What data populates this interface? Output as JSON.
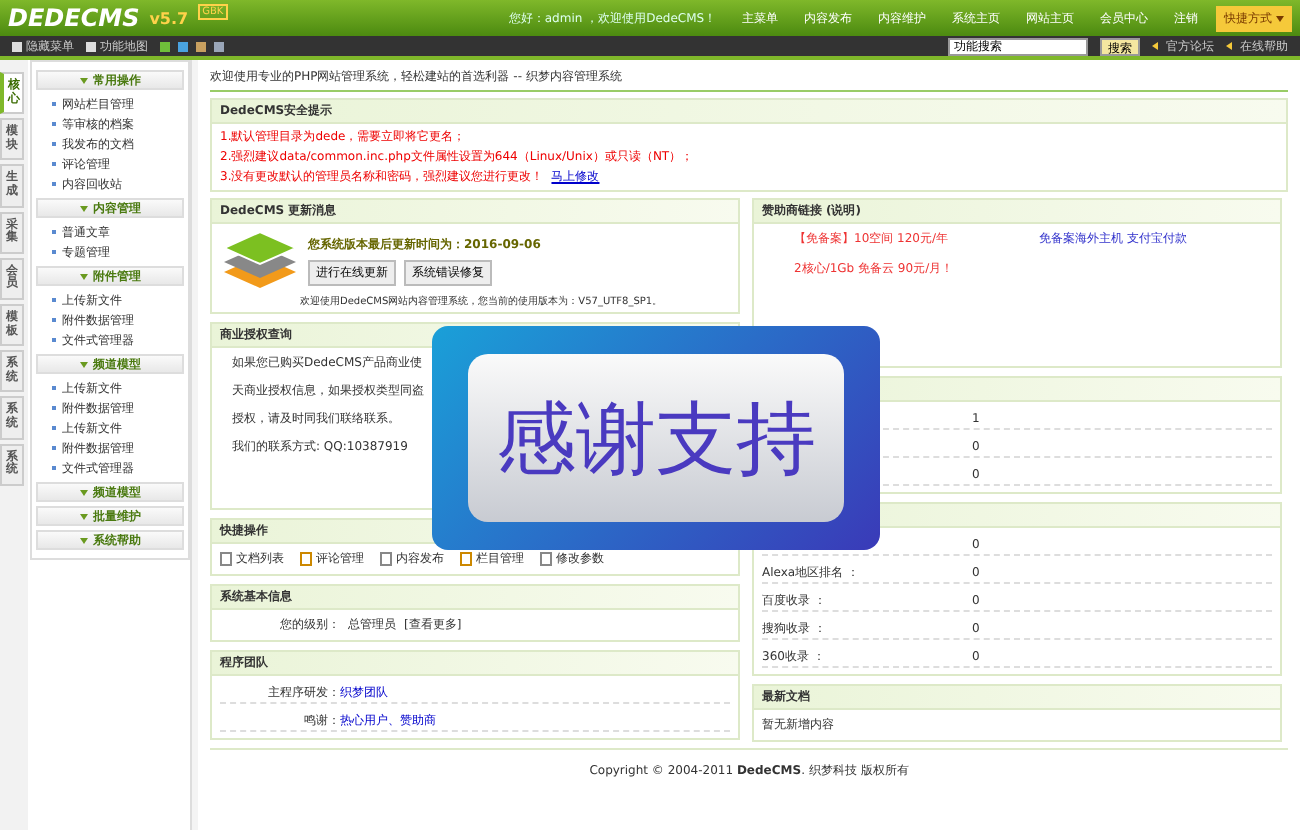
{
  "header": {
    "logo": "DEDECMS",
    "version": "v5.7",
    "edition": "GBK",
    "greeting": "您好：admin ，欢迎使用DedeCMS！",
    "nav": [
      "主菜单",
      "内容发布",
      "内容维护",
      "系统主页",
      "网站主页",
      "会员中心",
      "注销"
    ],
    "shortcut": "快捷方式"
  },
  "toolbar": {
    "hide_menu": "隐藏菜单",
    "map": "功能地图",
    "skins": [
      {
        "color": "#6fbf3a"
      },
      {
        "color": "#4aa3df"
      },
      {
        "color": "#c8a060"
      },
      {
        "color": "#9aa6b8"
      }
    ],
    "search": {
      "value": "功能搜索"
    },
    "search_button": "搜索",
    "links": [
      "官方论坛",
      "在线帮助"
    ]
  },
  "side_tabs": [
    {
      "label": "核心",
      "selected": true
    },
    {
      "label": "模块",
      "selected": false
    },
    {
      "label": "生成",
      "selected": false
    },
    {
      "label": "采集",
      "selected": false
    },
    {
      "label": "会员",
      "selected": false
    },
    {
      "label": "模板",
      "selected": false
    },
    {
      "label": "系统",
      "selected": false
    },
    {
      "label": "系统",
      "selected": false
    },
    {
      "label": "系统",
      "selected": false
    }
  ],
  "menu": [
    {
      "title": "常用操作",
      "items": [
        "网站栏目管理",
        "等审核的档案",
        "我发布的文档",
        "评论管理",
        "内容回收站"
      ]
    },
    {
      "title": "内容管理",
      "items": [
        "普通文章",
        "专题管理"
      ]
    },
    {
      "title": "附件管理",
      "items": [
        "上传新文件",
        "附件数据管理",
        "文件式管理器"
      ]
    },
    {
      "title": "频道模型",
      "items": [
        "上传新文件",
        "附件数据管理",
        "上传新文件",
        "附件数据管理",
        "文件式管理器"
      ]
    },
    {
      "title": "频道模型"
    },
    {
      "title": "批量维护"
    },
    {
      "title": "系统帮助"
    }
  ],
  "welcome": "欢迎使用专业的PHP网站管理系统，轻松建站的首选利器 -- 织梦内容管理系统",
  "security": {
    "title": "DedeCMS安全提示",
    "lines": [
      "1.默认管理目录为dede，需要立即将它更名；",
      "2.强烈建议data/common.inc.php文件属性设置为644（Linux/Unix）或只读（NT）；",
      "3.没有更改默认的管理员名称和密码，强烈建议您进行更改！"
    ],
    "link": "马上修改"
  },
  "update": {
    "title": "DedeCMS 更新消息",
    "headline": "您系统版本最后更新时间为：2016-09-06",
    "buttons": [
      "进行在线更新",
      "系统错误修复"
    ],
    "info": "欢迎使用DedeCMS网站内容管理系统，您当前的使用版本为：V57_UTF8_SP1。"
  },
  "license": {
    "title": "商业授权查询",
    "lines": [
      "如果您已购买DedeCMS产品商业使",
      "天商业授权信息，如果授权类型同盗",
      "授权，请及时同我们联络联系。",
      "我们的联系方式: QQ:10387919"
    ]
  },
  "sponsor": {
    "title": "赞助商链接",
    "note": "(说明)",
    "ads": [
      {
        "text": "【免备案】10空间 120元/年",
        "kind": "hot"
      },
      {
        "text": "免备案海外主机 支付宝付款",
        "kind": "link"
      },
      {
        "text": "2核心/1Gb 免备云 90元/月！",
        "kind": "hot"
      }
    ]
  },
  "stats": [
    {
      "value": "1"
    },
    {
      "value": "0"
    },
    {
      "value": "0"
    }
  ],
  "ranks": [
    {
      "value": "0"
    },
    {
      "label": "Alexa地区排名 ：",
      "value": "0"
    },
    {
      "label": "百度收录 ：",
      "value": "0"
    },
    {
      "label": "搜狗收录 ：",
      "value": "0"
    },
    {
      "label": "360收录 ：",
      "value": "0"
    }
  ],
  "latest": {
    "title": "最新文档",
    "text": "暂无新增内容"
  },
  "quick": {
    "title": "快捷操作",
    "items": [
      "文档列表",
      "评论管理",
      "内容发布",
      "栏目管理",
      "修改参数"
    ]
  },
  "sysinfo": {
    "title": "系统基本信息",
    "label": "您的级别：",
    "value": "总管理员",
    "link": "[查看更多]"
  },
  "team": {
    "title": "程序团队",
    "rows": [
      {
        "label": "主程序研发：",
        "value": "织梦团队"
      },
      {
        "label": "鸣谢：",
        "value": "热心用户、赞助商"
      }
    ]
  },
  "footer": {
    "text": "Copyright © 2004-2011 **DedeCMS**. 织梦科技 版权所有"
  },
  "overlay": {
    "text": "感谢支持"
  }
}
